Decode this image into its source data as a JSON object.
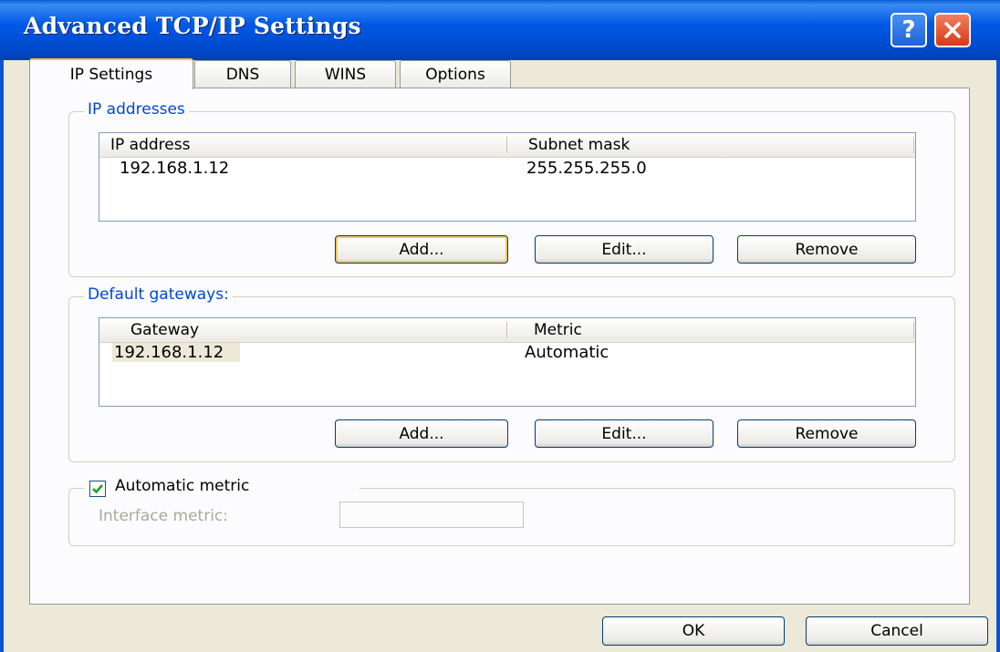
{
  "window": {
    "title": "Advanced TCP/IP Settings",
    "help_label": "?"
  },
  "tabs": [
    {
      "label": "IP Settings",
      "active": true
    },
    {
      "label": "DNS"
    },
    {
      "label": "WINS"
    },
    {
      "label": "Options"
    }
  ],
  "ip_addresses": {
    "group_label": "IP addresses",
    "columns": [
      "IP address",
      "Subnet mask"
    ],
    "rows": [
      {
        "ip": "192.168.1.12",
        "mask": "255.255.255.0"
      }
    ],
    "add_label": "Add...",
    "edit_label": "Edit...",
    "remove_label": "Remove"
  },
  "gateways": {
    "group_label": "Default gateways:",
    "columns": [
      "Gateway",
      "Metric"
    ],
    "rows": [
      {
        "gateway": "192.168.1.12",
        "metric": "Automatic"
      }
    ],
    "add_label": "Add...",
    "edit_label": "Edit...",
    "remove_label": "Remove"
  },
  "metric": {
    "automatic_label": "Automatic metric",
    "automatic_checked": true,
    "interface_label": "Interface metric:",
    "interface_value": ""
  },
  "footer": {
    "ok_label": "OK",
    "cancel_label": "Cancel"
  },
  "colors": {
    "title_bar": "#0058e6",
    "group_label": "#0046d5",
    "close_button": "#d83818"
  }
}
